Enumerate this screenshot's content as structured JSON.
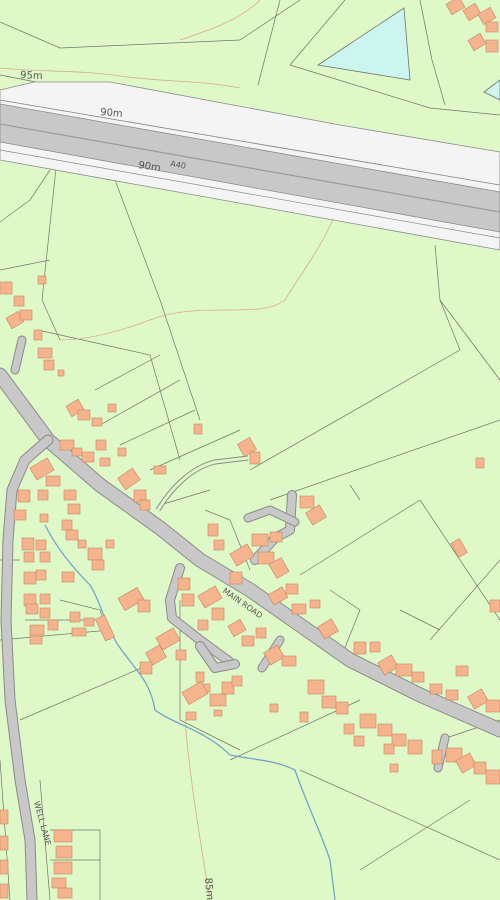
{
  "map": {
    "colors": {
      "land": "#dff8c8",
      "road": "#c8c8c8",
      "road_edge": "#8a8a8a",
      "verge": "#f4f4f4",
      "building": "#f3b48e",
      "building_edge": "#c78560",
      "water": "#ccf5ef",
      "stream": "#6d9fc6",
      "boundary": "#6f776a",
      "contour": "#d8a98e",
      "contour_major": "#c0542a"
    },
    "contour_labels": [
      {
        "text": "95m"
      },
      {
        "text": "90m"
      },
      {
        "text": "90m"
      },
      {
        "text": "85m"
      }
    ],
    "road_labels": {
      "a40": "A40",
      "main_road": "MAIN ROAD",
      "well_lane": "WELL LANE"
    }
  }
}
